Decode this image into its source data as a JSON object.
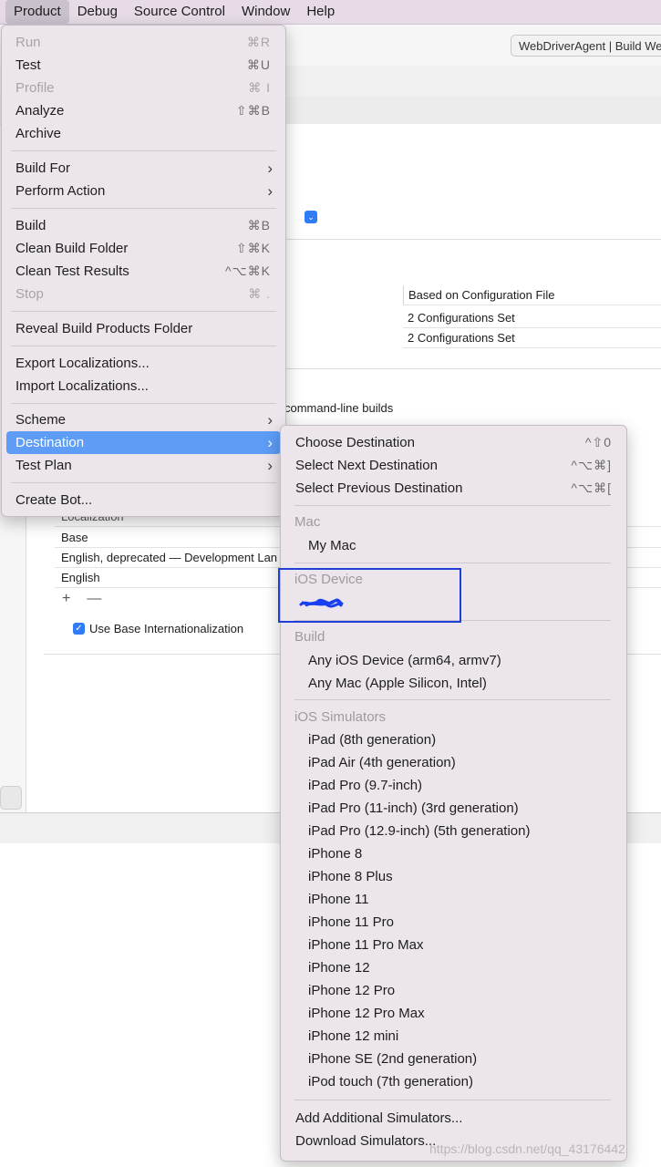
{
  "menubar": [
    "Product",
    "Debug",
    "Source Control",
    "Window",
    "Help"
  ],
  "window_title": "WebDriverAgent | Build We",
  "background": {
    "config_header": "Based on Configuration File",
    "config_rows": [
      "2 Configurations Set",
      "2 Configurations Set"
    ],
    "cmdline_text": "command-line builds",
    "localization_header": "Localization",
    "localization_rows": [
      "Base",
      "English, deprecated — Development Lan",
      "English"
    ],
    "add_symbol": "+",
    "remove_symbol": "—",
    "use_base_i18n": "Use Base Internationalization"
  },
  "product_menu": {
    "run": {
      "label": "Run",
      "shortcut": "⌘R"
    },
    "test": {
      "label": "Test",
      "shortcut": "⌘U"
    },
    "profile": {
      "label": "Profile",
      "shortcut": "⌘ I"
    },
    "analyze": {
      "label": "Analyze",
      "shortcut": "⇧⌘B"
    },
    "archive": {
      "label": "Archive"
    },
    "build_for": {
      "label": "Build For"
    },
    "perform_action": {
      "label": "Perform Action"
    },
    "build": {
      "label": "Build",
      "shortcut": "⌘B"
    },
    "clean_build_folder": {
      "label": "Clean Build Folder",
      "shortcut": "⇧⌘K"
    },
    "clean_test_results": {
      "label": "Clean Test Results",
      "shortcut": "^⌥⌘K"
    },
    "stop": {
      "label": "Stop",
      "shortcut": "⌘ ."
    },
    "reveal_build_products": {
      "label": "Reveal Build Products Folder"
    },
    "export_localizations": {
      "label": "Export Localizations..."
    },
    "import_localizations": {
      "label": "Import Localizations..."
    },
    "scheme": {
      "label": "Scheme"
    },
    "destination": {
      "label": "Destination"
    },
    "test_plan": {
      "label": "Test Plan"
    },
    "create_bot": {
      "label": "Create Bot..."
    }
  },
  "destination_menu": {
    "choose": {
      "label": "Choose Destination",
      "shortcut": "^⇧0"
    },
    "select_next": {
      "label": "Select Next Destination",
      "shortcut": "^⌥⌘]"
    },
    "select_prev": {
      "label": "Select Previous Destination",
      "shortcut": "^⌥⌘["
    },
    "mac_header": "Mac",
    "my_mac": "My Mac",
    "ios_device_header": "iOS Device",
    "build_header": "Build",
    "any_ios_device": "Any iOS Device (arm64, armv7)",
    "any_mac": "Any Mac (Apple Silicon, Intel)",
    "ios_sim_header": "iOS Simulators",
    "simulators": [
      "iPad (8th generation)",
      "iPad Air (4th generation)",
      "iPad Pro (9.7-inch)",
      "iPad Pro (11-inch) (3rd generation)",
      "iPad Pro (12.9-inch) (5th generation)",
      "iPhone 8",
      "iPhone 8 Plus",
      "iPhone 11",
      "iPhone 11 Pro",
      "iPhone 11 Pro Max",
      "iPhone 12",
      "iPhone 12 Pro",
      "iPhone 12 Pro Max",
      "iPhone 12 mini",
      "iPhone SE (2nd generation)",
      "iPod touch (7th generation)"
    ],
    "add_simulators": "Add Additional Simulators...",
    "download_simulators": "Download Simulators..."
  },
  "watermark": "https://blog.csdn.net/qq_43176442",
  "colors": {
    "selection": "#5e9cf5",
    "annotation_box": "#1f3fd6",
    "menubar": "#e6dbe6"
  }
}
